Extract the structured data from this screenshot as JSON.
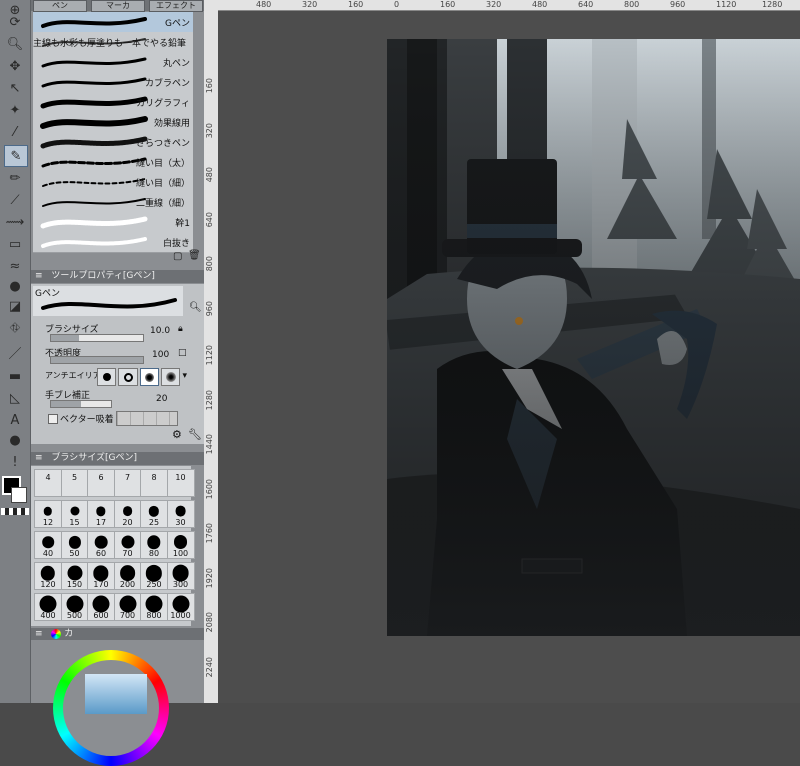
{
  "panel_tabs": [
    "ペン",
    "マーカ",
    "エフェクト"
  ],
  "brush_list": [
    {
      "name": "Gペン",
      "selected": true
    },
    {
      "name": "主線も水彩も厚塗りも一本でやる鉛筆",
      "selected": false
    },
    {
      "name": "丸ペン",
      "selected": false
    },
    {
      "name": "カブラペン",
      "selected": false
    },
    {
      "name": "カリグラフィ",
      "selected": false
    },
    {
      "name": "効果線用",
      "selected": false
    },
    {
      "name": "ざらつきペン",
      "selected": false
    },
    {
      "name": "縫い目（太）",
      "selected": false
    },
    {
      "name": "縫い目（細）",
      "selected": false
    },
    {
      "name": "二重線（細）",
      "selected": false
    },
    {
      "name": "幹1",
      "selected": false
    },
    {
      "name": "白抜き",
      "selected": false
    }
  ],
  "tool_property": {
    "header": "ツールプロパティ[Gペン]",
    "preset_name": "Gペン",
    "brush_size_label": "ブラシサイズ",
    "brush_size_value": "10.0",
    "brush_size_level": 0.3,
    "opacity_label": "不透明度",
    "opacity_value": "100",
    "opacity_level": 1.0,
    "antialias_label": "アンチエイリアス",
    "stabilization_label": "手ブレ補正",
    "stabilization_value": "20",
    "stabilization_level": 0.5,
    "vector_snap_label": "ベクター吸着"
  },
  "brush_size_panel": {
    "header": "ブラシサイズ[Gペン]",
    "sizes": [
      "4",
      "5",
      "6",
      "7",
      "8",
      "10",
      "12",
      "15",
      "17",
      "20",
      "25",
      "30",
      "40",
      "50",
      "60",
      "70",
      "80",
      "100",
      "120",
      "150",
      "170",
      "200",
      "250",
      "300",
      "400",
      "500",
      "600",
      "700",
      "800",
      "1000"
    ]
  },
  "color_panel": {
    "tab_label": "カ"
  },
  "vertical_ruler": [
    "160",
    "320",
    "480",
    "640",
    "800",
    "960",
    "1120",
    "1280",
    "1440",
    "1600",
    "1760",
    "1920",
    "2080",
    "2240"
  ],
  "horizontal_ruler": [
    "480",
    "320",
    "160",
    "0",
    "160",
    "320",
    "480",
    "640",
    "800",
    "960",
    "1120",
    "1280"
  ],
  "colors": {
    "main_color": "#000000",
    "sub_color": "#ffffff",
    "selection": "#b3c8dc"
  }
}
